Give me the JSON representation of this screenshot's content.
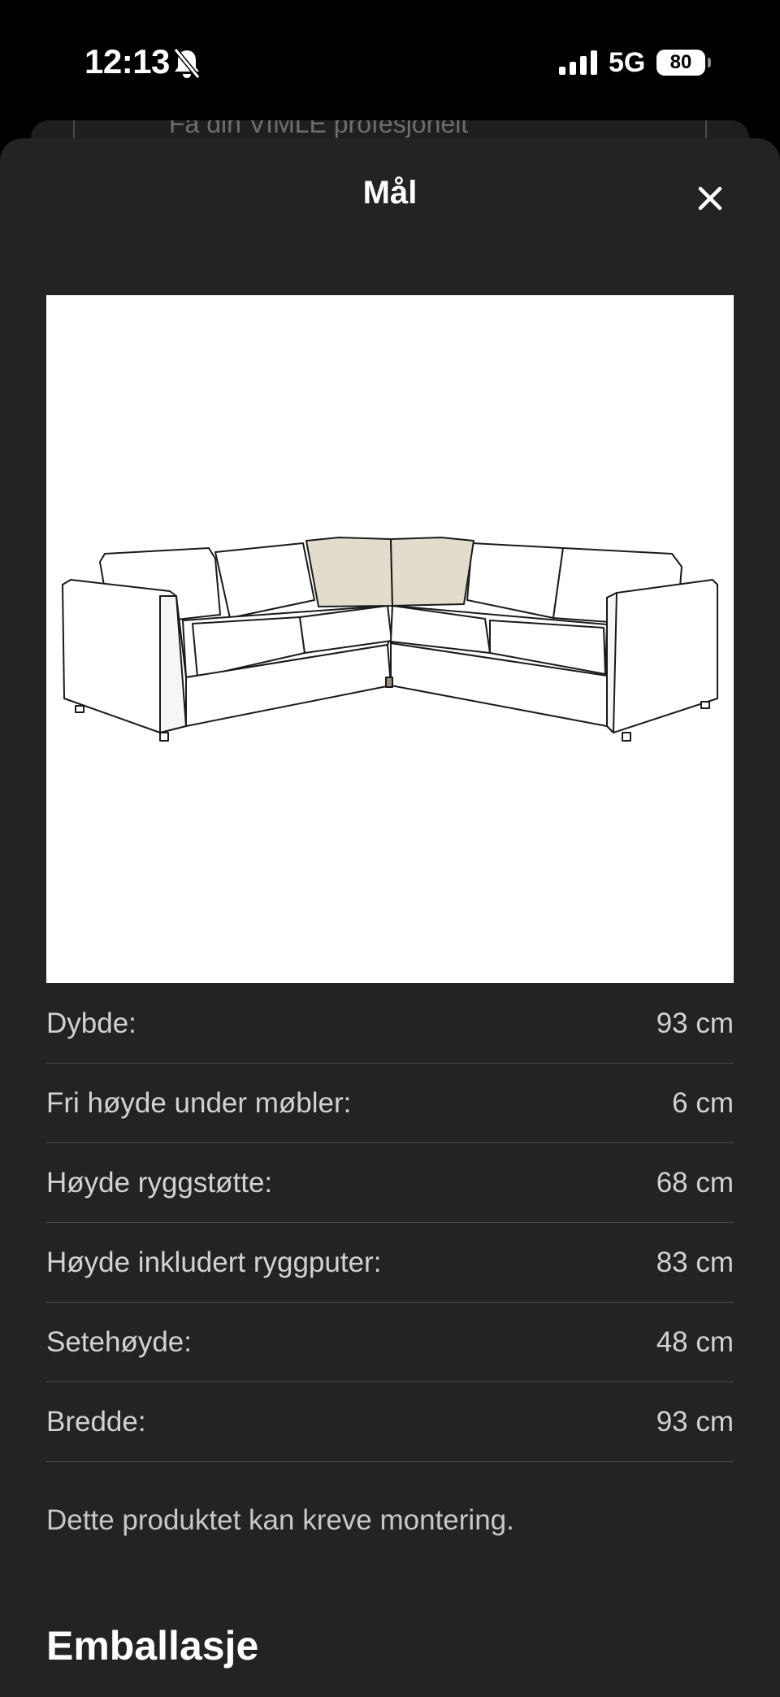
{
  "status": {
    "time": "12:13",
    "network": "5G",
    "battery": "80"
  },
  "underlying_page": {
    "ghost_text": "Få din VIMLE profesjonelt"
  },
  "sheet": {
    "title": "Mål",
    "dimensions": [
      {
        "label": "Dybde:",
        "value": "93 cm"
      },
      {
        "label": "Fri høyde under møbler:",
        "value": "6 cm"
      },
      {
        "label": "Høyde ryggstøtte:",
        "value": "68 cm"
      },
      {
        "label": "Høyde inkludert ryggputer:",
        "value": "83 cm"
      },
      {
        "label": "Setehøyde:",
        "value": "48 cm"
      },
      {
        "label": "Bredde:",
        "value": "93 cm"
      }
    ],
    "note": "Dette produktet kan kreve montering.",
    "section_heading": "Emballasje"
  },
  "colors": {
    "sheet_bg": "#232325",
    "divider": "#4a4a4c",
    "accent_cushion": "#e2dccd"
  },
  "icons": {
    "mute": "bell-slash-icon",
    "close": "close-icon",
    "signal": "cellular-signal-icon"
  }
}
